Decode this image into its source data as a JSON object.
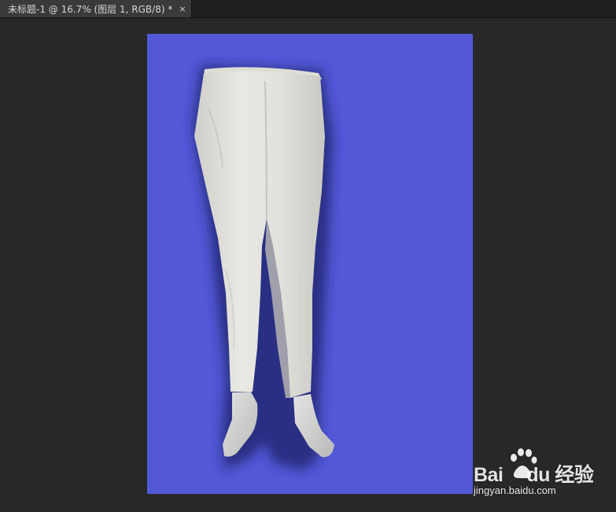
{
  "document": {
    "tab_title": "未标题-1 @ 16.7% (图层 1, RGB/8) *",
    "close_glyph": "×",
    "zoom": "16.7%",
    "layer": "图层 1",
    "color_mode": "RGB/8"
  },
  "canvas": {
    "background_color": "#5258d6",
    "subject": "white-trousers-on-mannequin"
  },
  "watermark": {
    "logo_text": "Bai",
    "logo_icon": "paw-icon",
    "logo_suffix": "du 经验",
    "url": "jingyan.baidu.com"
  },
  "colors": {
    "workspace": "#282828",
    "tab_active": "#3a3a3a",
    "canvas_blue": "#5258d6",
    "pants_white": "#e6e5df"
  }
}
